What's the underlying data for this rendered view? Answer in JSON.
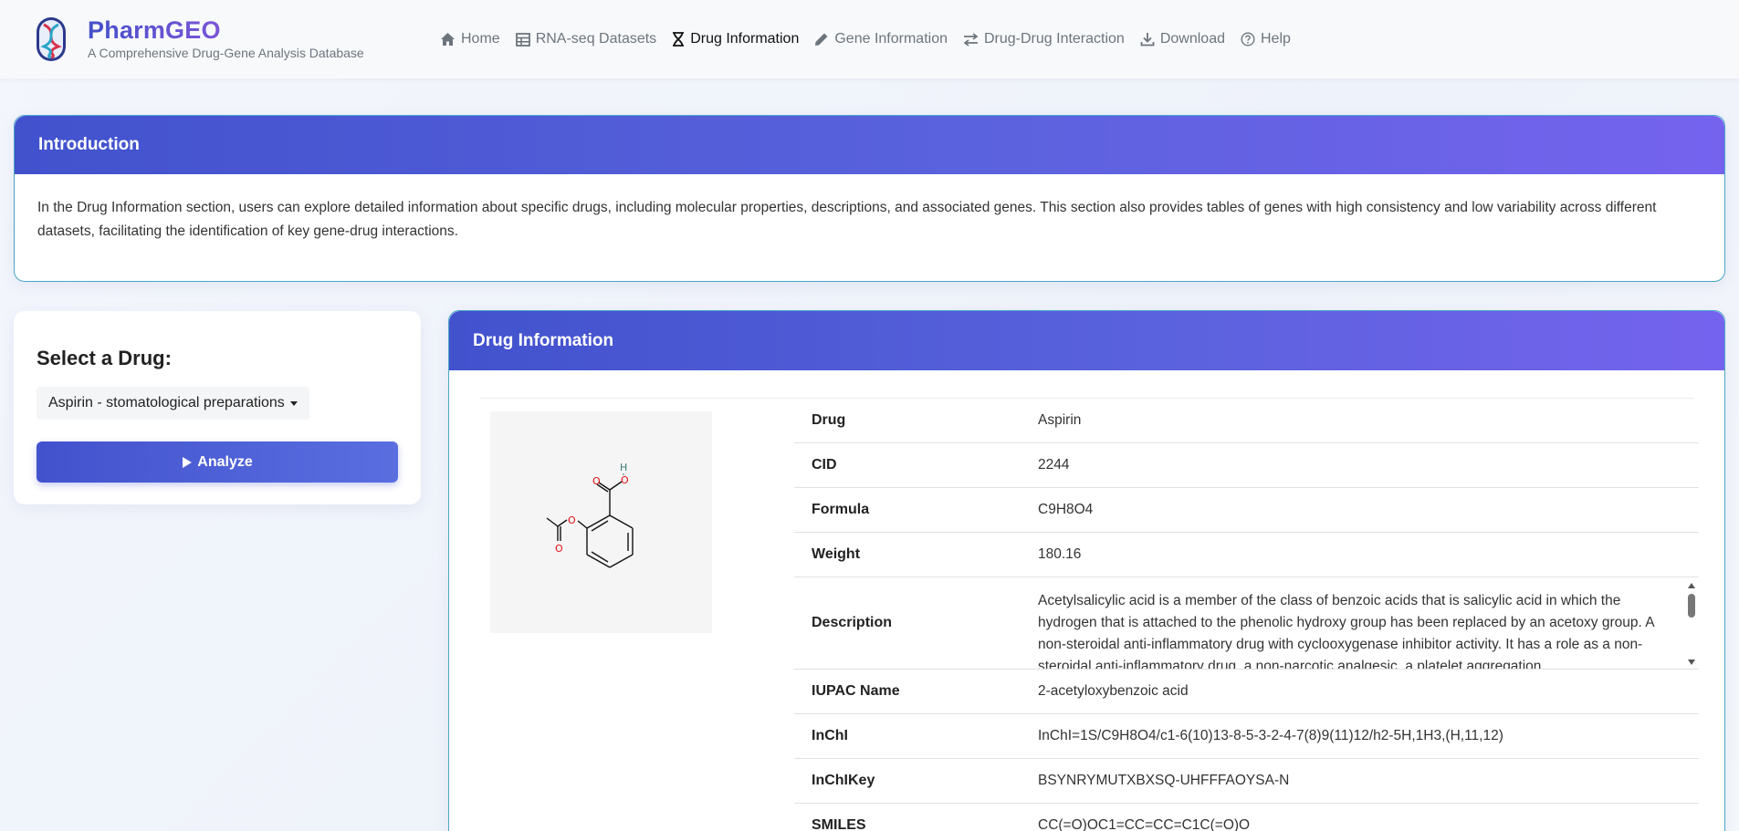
{
  "brand": {
    "name": "PharmGEO",
    "tagline": "A Comprehensive Drug-Gene Analysis Database"
  },
  "nav": [
    {
      "label": "Home",
      "icon": "home-icon"
    },
    {
      "label": "RNA-seq Datasets",
      "icon": "table-icon"
    },
    {
      "label": "Drug Information",
      "icon": "hourglass-icon",
      "active": true
    },
    {
      "label": "Gene Information",
      "icon": "pen-icon"
    },
    {
      "label": "Drug-Drug Interaction",
      "icon": "arrows-exchange-icon"
    },
    {
      "label": "Download",
      "icon": "download-icon"
    },
    {
      "label": "Help",
      "icon": "help-circle-icon"
    }
  ],
  "intro": {
    "title": "Introduction",
    "body": "In the Drug Information section, users can explore detailed information about specific drugs, including molecular properties, descriptions, and associated genes. This section also provides tables of genes with high consistency and low variability across different datasets, facilitating the identification of key gene-drug interactions."
  },
  "selector": {
    "title": "Select a Drug:",
    "selected": "Aspirin - stomatological preparations",
    "button": "Analyze"
  },
  "drug_info": {
    "title": "Drug Information",
    "rows": [
      {
        "label": "Drug",
        "value": "Aspirin"
      },
      {
        "label": "CID",
        "value": "2244"
      },
      {
        "label": "Formula",
        "value": "C9H8O4"
      },
      {
        "label": "Weight",
        "value": "180.16"
      },
      {
        "label": "Description",
        "value": "Acetylsalicylic acid is a member of the class of benzoic acids that is salicylic acid in which the hydrogen that is attached to the phenolic hydroxy group has been replaced by an acetoxy group. A non-steroidal anti-inflammatory drug with cyclooxygenase inhibitor activity. It has a role as a non-steroidal anti-inflammatory drug, a non-narcotic analgesic, a platelet aggregation"
      },
      {
        "label": "IUPAC Name",
        "value": "2-acetyloxybenzoic acid"
      },
      {
        "label": "InChI",
        "value": "InChI=1S/C9H8O4/c1-6(10)13-8-5-3-2-4-7(8)9(11)12/h2-5H,1H3,(H,11,12)"
      },
      {
        "label": "InChIKey",
        "value": "BSYNRYMUTXBXSQ-UHFFFAOYSA-N"
      },
      {
        "label": "SMILES",
        "value": "CC(=O)OC1=CC=CC=C1C(=O)O"
      }
    ]
  },
  "structure_atoms": [
    "O",
    "O",
    "H",
    "O",
    "O"
  ],
  "colors": {
    "accent": "#4252cd",
    "accent_end": "#7563ee",
    "oxygen": "#e01010"
  }
}
